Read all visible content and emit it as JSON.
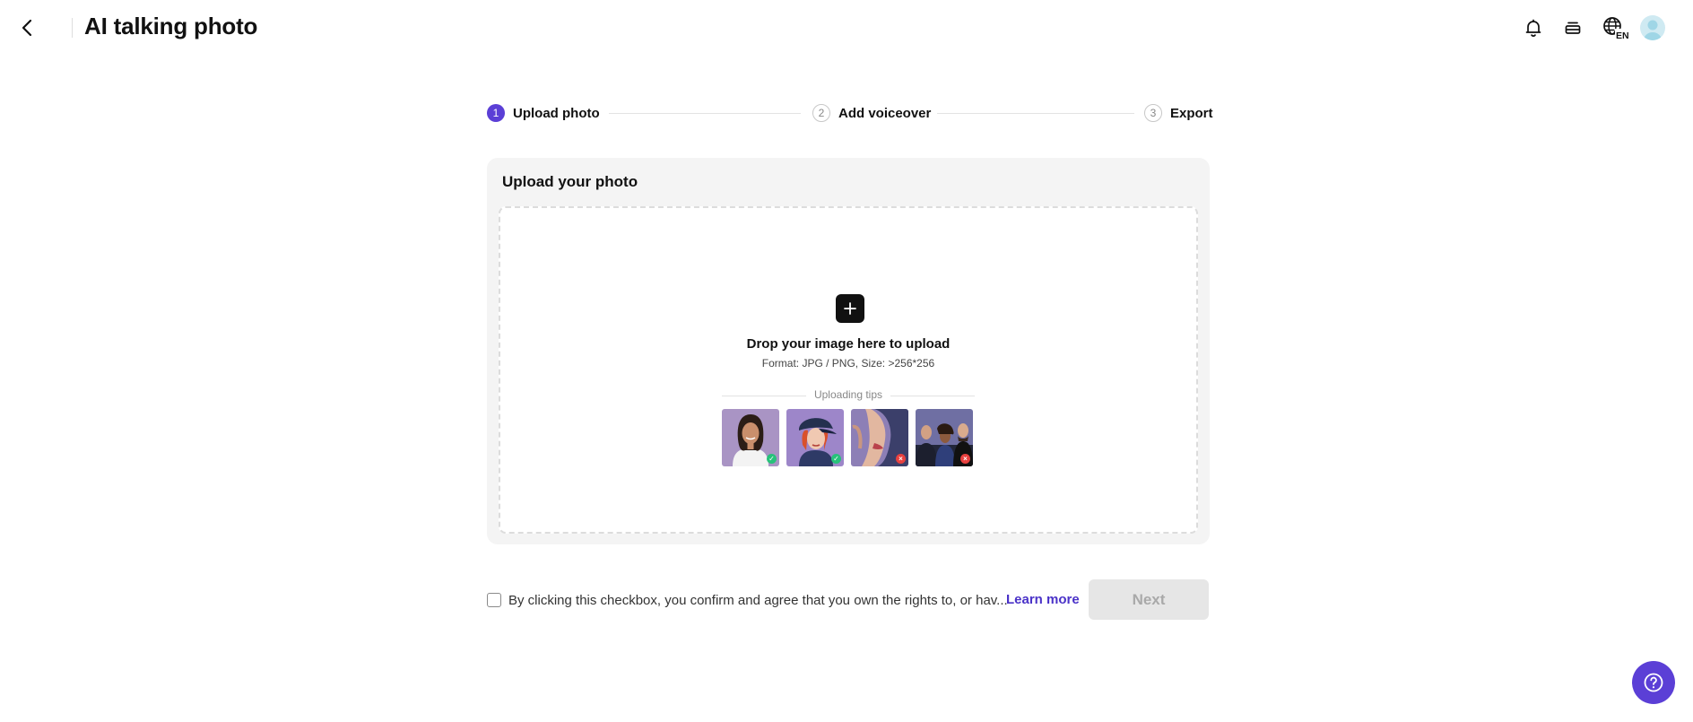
{
  "header": {
    "title": "AI talking photo",
    "icons": [
      "back-arrow-icon",
      "bell-icon",
      "stack-icon",
      "globe-language-icon",
      "avatar"
    ],
    "language_badge": "EN"
  },
  "stepper": {
    "steps": [
      {
        "number": "1",
        "label": "Upload photo",
        "state": "active"
      },
      {
        "number": "2",
        "label": "Add voiceover",
        "state": "inactive"
      },
      {
        "number": "3",
        "label": "Export",
        "state": "inactive"
      }
    ],
    "active_color": "#5b3fd6"
  },
  "upload_card": {
    "title": "Upload your photo",
    "drop_title": "Drop your image here to upload",
    "format_text": "Format: JPG / PNG, Size: >256*256",
    "tips_label": "Uploading tips",
    "tips": [
      {
        "name": "front-face-portrait",
        "status": "ok"
      },
      {
        "name": "cartoon-character",
        "status": "ok"
      },
      {
        "name": "partial-face-closeup",
        "status": "bad"
      },
      {
        "name": "group-of-people",
        "status": "bad"
      }
    ]
  },
  "footer": {
    "agree_text": "By clicking this checkbox, you confirm and agree that you own the rights to, or hav...",
    "checkbox_checked": false,
    "learn_more": "Learn more",
    "next_label": "Next",
    "next_enabled": false
  },
  "colors": {
    "accent": "#5b3fd6",
    "link": "#4a32c8",
    "ok_badge": "#27c27a",
    "bad_badge": "#e8413f"
  }
}
